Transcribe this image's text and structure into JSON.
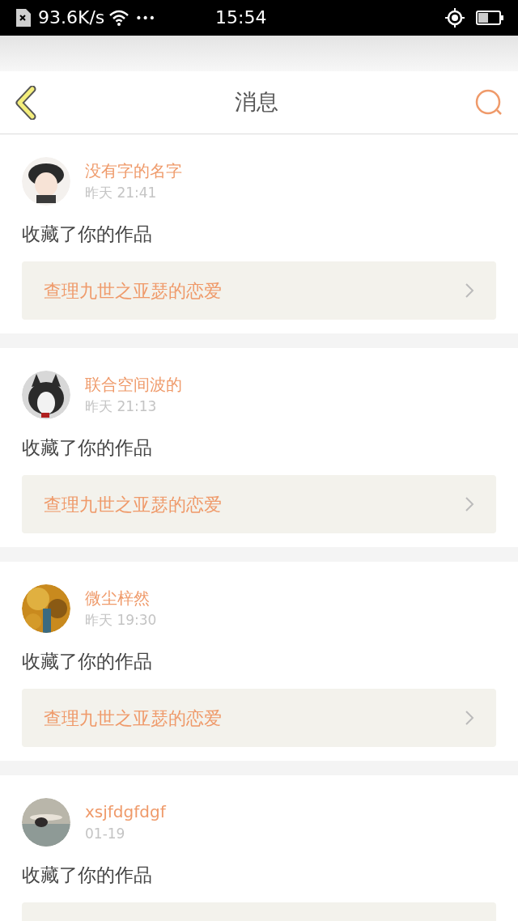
{
  "status_bar": {
    "speed": "93.6K/s",
    "more": "•••",
    "time": "15:54"
  },
  "header": {
    "title": "消息"
  },
  "messages": [
    {
      "name": "没有字的名字",
      "time": "昨天 21:41",
      "action": "收藏了你的作品",
      "work": "查理九世之亚瑟的恋爱"
    },
    {
      "name": "联合空间波的",
      "time": "昨天 21:13",
      "action": "收藏了你的作品",
      "work": "查理九世之亚瑟的恋爱"
    },
    {
      "name": "微尘梓然",
      "time": "昨天 19:30",
      "action": "收藏了你的作品",
      "work": "查理九世之亚瑟的恋爱"
    },
    {
      "name": "xsjfdgfdgf",
      "time": "01-19",
      "action": "收藏了你的作品"
    }
  ]
}
